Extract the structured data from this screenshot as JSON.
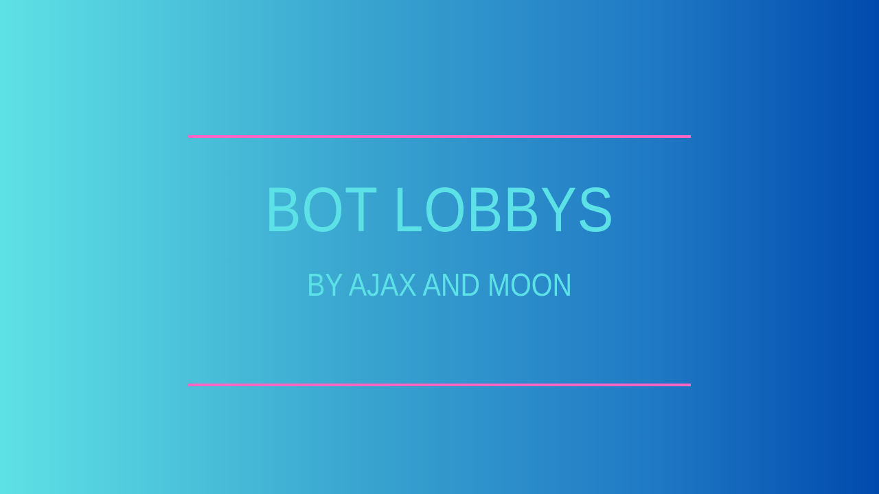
{
  "slide": {
    "title": "BOT LOBBYS",
    "subtitle": "BY AJAX AND MOON"
  },
  "colors": {
    "gradient_start": "#5ee1e5",
    "gradient_end": "#004aad",
    "accent_rule": "#ff66c4",
    "text": "#5ce1e6"
  }
}
